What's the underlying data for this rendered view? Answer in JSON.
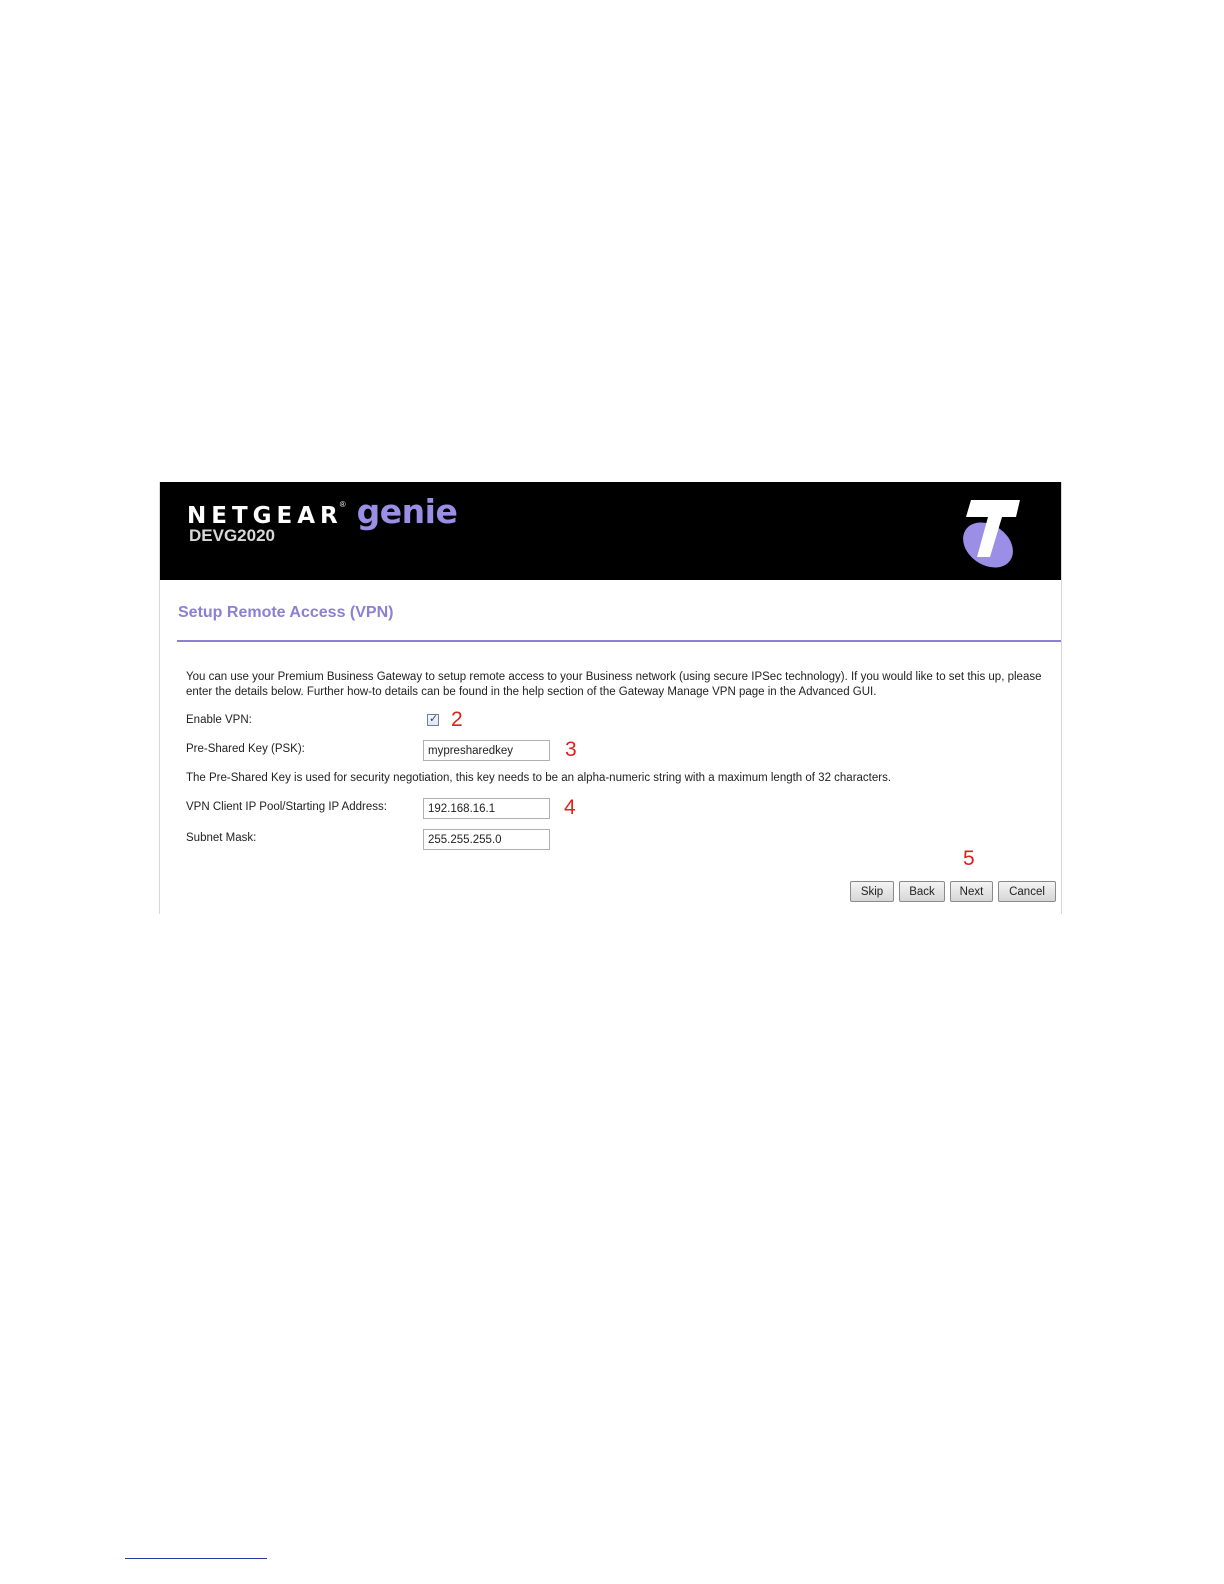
{
  "header": {
    "brand_name": "NETGEAR",
    "brand_mark": "®",
    "product_name": "genie",
    "model": "DEVG2020",
    "logo_icon": "telstra-t-logo-icon",
    "background_color": "#000000",
    "accent_color": "#9a8ee6"
  },
  "page": {
    "title": "Setup Remote Access (VPN)",
    "intro": "You can use your Premium Business Gateway to setup remote access to your Business network (using secure IPSec technology). If you would like to set this up, please enter the details below. Further how-to details can be found in the help section of the Gateway Manage VPN page in the Advanced GUI."
  },
  "form": {
    "enable_vpn_label": "Enable VPN:",
    "enable_vpn_checked": true,
    "psk_label": "Pre-Shared Key (PSK):",
    "psk_value": "mypresharedkey",
    "psk_note": "The Pre-Shared Key is used for security negotiation, this key needs to be an alpha-numeric string with a maximum length of 32 characters.",
    "ip_pool_label": "VPN Client IP Pool/Starting IP Address:",
    "ip_pool_value": "192.168.16.1",
    "subnet_label": "Subnet Mask:",
    "subnet_value": "255.255.255.0"
  },
  "buttons": {
    "skip": "Skip",
    "back": "Back",
    "next": "Next",
    "cancel": "Cancel"
  },
  "annotations": {
    "step_enable": "2",
    "step_psk": "3",
    "step_ip": "4",
    "step_buttons": "5",
    "color": "#e0201a"
  }
}
